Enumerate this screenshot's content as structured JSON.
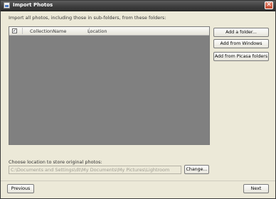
{
  "window": {
    "title": "Import Photos",
    "close_glyph": "✕"
  },
  "main": {
    "instruction": "Import all photos, including those in sub-folders, from these folders:",
    "list": {
      "columns": [
        "CollectionName",
        "Location"
      ],
      "check_glyph": "✓"
    }
  },
  "actions": {
    "add_folder": "Add a folder...",
    "add_windows": "Add from Windows",
    "add_picasa": "Add from Picasa folders"
  },
  "location": {
    "label": "Choose location to store original photos:",
    "path": "C:\\Documents and Settings\\dt\\My Documents\\My Pictures\\Lightroom",
    "change": "Change..."
  },
  "footer": {
    "previous": "Previous",
    "next": "Next"
  }
}
